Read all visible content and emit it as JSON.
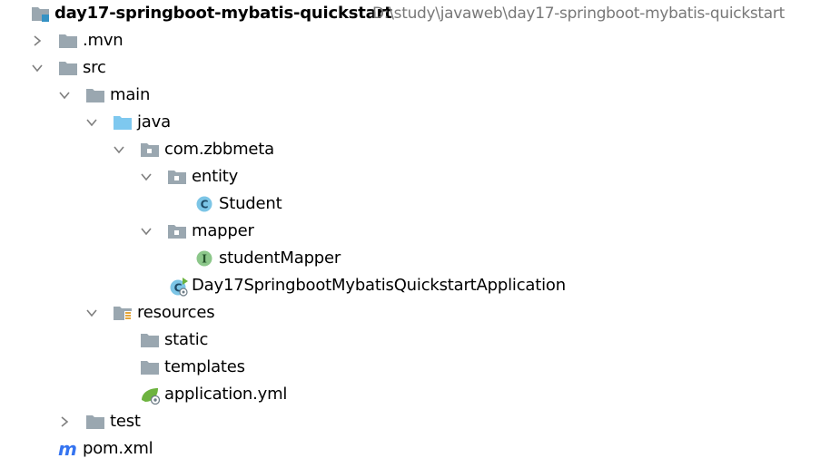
{
  "tree": {
    "root": {
      "name": "day17-springboot-mybatis-quickstart",
      "path": "D:\\study\\javaweb\\day17-springboot-mybatis-quickstart"
    },
    "items": [
      {
        "label": ".mvn",
        "icon": "folder-icon",
        "arrow": "chevron-right-icon"
      },
      {
        "label": "src",
        "icon": "folder-icon",
        "arrow": "chevron-down-icon"
      },
      {
        "label": "main",
        "icon": "folder-icon",
        "arrow": "chevron-down-icon"
      },
      {
        "label": "java",
        "icon": "source-folder-icon",
        "arrow": "chevron-down-icon"
      },
      {
        "label": "com.zbbmeta",
        "icon": "package-icon",
        "arrow": "chevron-down-icon"
      },
      {
        "label": "entity",
        "icon": "package-icon",
        "arrow": "chevron-down-icon"
      },
      {
        "label": "Student",
        "icon": "class-icon"
      },
      {
        "label": "mapper",
        "icon": "package-icon",
        "arrow": "chevron-down-icon"
      },
      {
        "label": "studentMapper",
        "icon": "interface-icon"
      },
      {
        "label": "Day17SpringbootMybatisQuickstartApplication",
        "icon": "spring-boot-class-icon"
      },
      {
        "label": "resources",
        "icon": "resources-folder-icon",
        "arrow": "chevron-down-icon"
      },
      {
        "label": "static",
        "icon": "folder-icon"
      },
      {
        "label": "templates",
        "icon": "folder-icon"
      },
      {
        "label": "application.yml",
        "icon": "spring-config-icon"
      },
      {
        "label": "test",
        "icon": "folder-icon",
        "arrow": "chevron-right-icon"
      },
      {
        "label": "pom.xml",
        "icon": "maven-icon"
      }
    ],
    "badges": {
      "class_letter": "C",
      "interface_letter": "I",
      "maven_letter": "m"
    }
  },
  "colors": {
    "folder": "#9aa7b0",
    "source_folder": "#7ec8ef",
    "class_badge": "#7cc5e6",
    "interface_badge": "#8cc78a",
    "spring_green": "#6db33f",
    "path_gray": "#787878",
    "arrow_gray": "#7f7f7f",
    "maven_blue": "#3574f0"
  }
}
